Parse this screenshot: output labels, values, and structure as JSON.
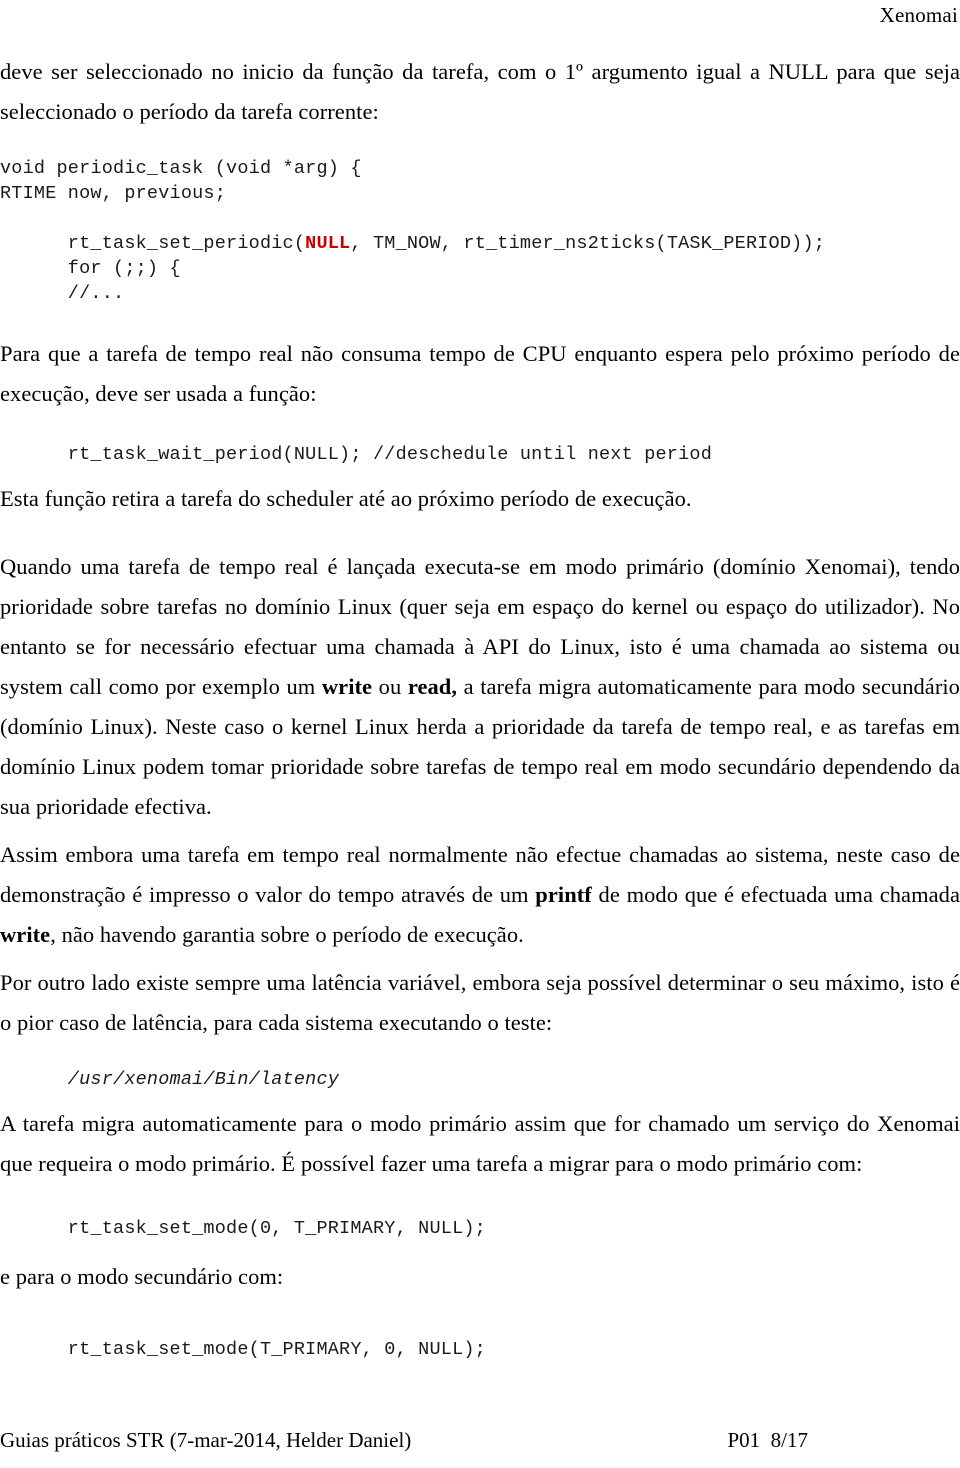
{
  "header": {
    "title": "Xenomai"
  },
  "body": {
    "para_intro_1": "deve ser seleccionado no inicio da função da tarefa, com o 1º argumento igual a NULL para que seja seleccionado o período da tarefa corrente:",
    "code_block_1": {
      "line_1": "void periodic_task (void *arg) {",
      "line_2": "RTIME now, previous;",
      "line_3_pre": "      rt_task_set_periodic(",
      "line_3_null": "NULL",
      "line_3_post": ", TM_NOW, rt_timer_ns2ticks(TASK_PERIOD));",
      "line_4": "      for (;;) {",
      "line_5": "      //..."
    },
    "para_wait_intro": "Para que a tarefa de tempo real não consuma tempo de CPU enquanto espera pelo próximo período de execução, deve ser usada a função:",
    "code_block_2": "      rt_task_wait_period(NULL); //deschedule until next period",
    "para_wait_after": "Esta função retira a tarefa do scheduler até ao próximo período de execução.",
    "para_primary_mode_1": "Quando uma tarefa de tempo real é lançada executa-se em modo primário (domínio Xenomai), tendo prioridade sobre tarefas no domínio Linux (quer seja em espaço do kernel ou espaço do utilizador). No entanto se for necessário efectuar uma chamada à API do Linux, isto é uma chamada ao sistema ou system call como por exemplo um ",
    "para_primary_mode_b1": "write",
    "para_primary_mode_2": " ou ",
    "para_primary_mode_b2": "read,",
    "para_primary_mode_3": " a tarefa migra automaticamente para modo secundário (domínio Linux). Neste caso o kernel Linux herda a prioridade da tarefa de tempo real, e as tarefas em domínio Linux podem tomar prioridade sobre tarefas de tempo real em modo secundário dependendo da sua prioridade efectiva.",
    "para_printf_1": "Assim embora uma tarefa em tempo real normalmente não efectue chamadas ao sistema, neste caso de demonstração é impresso o valor do tempo através de um ",
    "para_printf_b1": "printf",
    "para_printf_2": " de modo que é efectuada uma chamada ",
    "para_printf_b2": "write",
    "para_printf_3": ", não havendo garantia sobre o período de execução.",
    "para_latency": "Por outro lado existe sempre uma latência variável, embora seja possível determinar o seu máximo, isto é o pior caso de latência, para cada sistema executando o teste:",
    "code_latency_path": "      /usr/xenomai/Bin/latency",
    "para_migrate": "A tarefa migra automaticamente para o modo primário assim que for chamado um serviço do Xenomai que requeira o modo primário. É possível fazer uma tarefa a migrar para o modo primário com:",
    "code_block_3": "      rt_task_set_mode(0, T_PRIMARY, NULL);",
    "para_secondary": "e para o modo secundário com:",
    "code_block_4": "      rt_task_set_mode(T_PRIMARY, 0, NULL);"
  },
  "footer": {
    "left": "Guias práticos STR (7-mar-2014, Helder Daniel)",
    "right": "P01  8/17"
  },
  "colors": {
    "text": "#000000",
    "code": "#1a1a1a",
    "keyword_null": "#cc0000",
    "background": "#ffffff"
  }
}
